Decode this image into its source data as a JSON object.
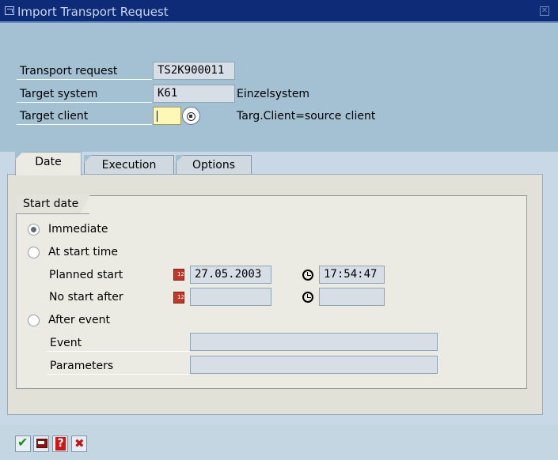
{
  "window": {
    "title": "Import Transport Request"
  },
  "header_fields": {
    "transport_request": {
      "label": "Transport request",
      "value": "TS2K900011"
    },
    "target_system": {
      "label": "Target system",
      "value": "K61",
      "description": "Einzelsystem"
    },
    "target_client": {
      "label": "Target client",
      "value": "",
      "description": "Targ.Client=source client"
    }
  },
  "tabs": [
    {
      "label": "Date",
      "active": true
    },
    {
      "label": "Execution",
      "active": false
    },
    {
      "label": "Options",
      "active": false
    }
  ],
  "start_date": {
    "group_title": "Start date",
    "immediate": {
      "label": "Immediate",
      "checked": true
    },
    "at_start_time": {
      "label": "At start time",
      "checked": false
    },
    "planned_start": {
      "label": "Planned start",
      "date": "27.05.2003",
      "time": "17:54:47"
    },
    "no_start_after": {
      "label": "No start after",
      "date": "",
      "time": ""
    },
    "after_event": {
      "label": "After event",
      "checked": false
    },
    "event": {
      "label": "Event",
      "value": ""
    },
    "parameters": {
      "label": "Parameters",
      "value": ""
    }
  },
  "toolbar": {
    "icons": [
      "check-icon",
      "display-icon",
      "help-icon",
      "cancel-icon"
    ]
  },
  "colors": {
    "title_bar": "#0e2b78",
    "header_background": "#a4c0d3",
    "input_required": "#fff7b6"
  }
}
